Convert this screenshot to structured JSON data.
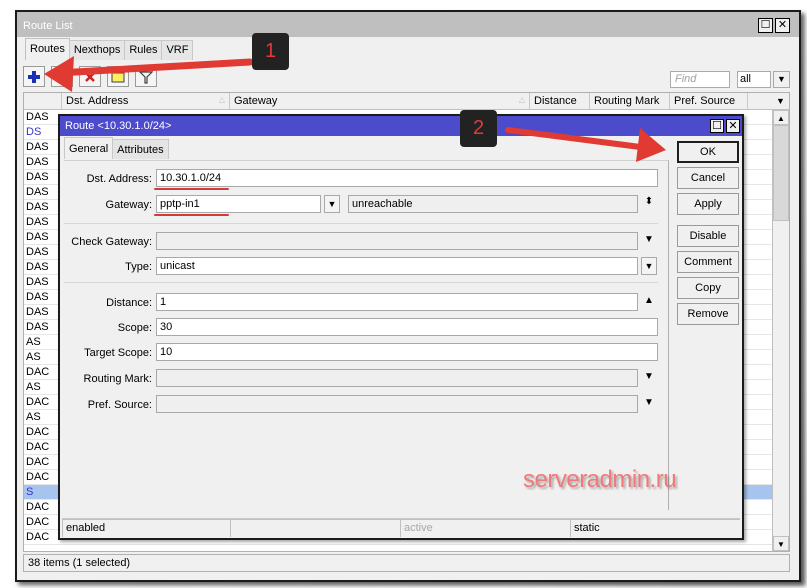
{
  "window": {
    "title": "Route List",
    "tabs": [
      "Routes",
      "Nexthops",
      "Rules",
      "VRF"
    ],
    "active_tab": "Routes",
    "maximize_icon": "maximize-icon",
    "close_icon": "close-icon"
  },
  "toolbar": {
    "buttons": [
      {
        "name": "add",
        "icon": "plus-icon"
      },
      {
        "name": "enable",
        "icon": "check-icon"
      },
      {
        "name": "disable",
        "icon": "x-icon"
      },
      {
        "name": "comment",
        "icon": "note-icon"
      },
      {
        "name": "filter",
        "icon": "filter-icon"
      }
    ],
    "find_placeholder": "Find",
    "filter_select": "all"
  },
  "table": {
    "columns": [
      "",
      "Dst. Address",
      "Gateway",
      "Distance",
      "Routing Mark",
      "Pref. Source"
    ],
    "rows": [
      {
        "flags": "DAS"
      },
      {
        "flags": "DS"
      },
      {
        "flags": "DAS"
      },
      {
        "flags": "DAS"
      },
      {
        "flags": "DAS"
      },
      {
        "flags": "DAS"
      },
      {
        "flags": "DAS"
      },
      {
        "flags": "DAS"
      },
      {
        "flags": "DAS"
      },
      {
        "flags": "DAS"
      },
      {
        "flags": "DAS"
      },
      {
        "flags": "DAS"
      },
      {
        "flags": "DAS"
      },
      {
        "flags": "DAS"
      },
      {
        "flags": "DAS"
      },
      {
        "flags": "AS"
      },
      {
        "flags": "AS"
      },
      {
        "flags": "DAC"
      },
      {
        "flags": "AS"
      },
      {
        "flags": "DAC"
      },
      {
        "flags": "AS"
      },
      {
        "flags": "DAC"
      },
      {
        "flags": "DAC"
      },
      {
        "flags": "DAC"
      },
      {
        "flags": "DAC"
      },
      {
        "flags": "S",
        "selected": true
      },
      {
        "flags": "DAC"
      },
      {
        "flags": "DAC"
      },
      {
        "flags": "DAC"
      }
    ]
  },
  "status": "38 items (1 selected)",
  "dialog": {
    "title": "Route <10.30.1.0/24>",
    "tabs": [
      "General",
      "Attributes"
    ],
    "active_tab": "General",
    "fields": {
      "dst_address": {
        "label": "Dst. Address:",
        "value": "10.30.1.0/24"
      },
      "gateway": {
        "label": "Gateway:",
        "value": "pptp-in1",
        "state": "unreachable"
      },
      "check_gateway": {
        "label": "Check Gateway:",
        "value": ""
      },
      "type": {
        "label": "Type:",
        "value": "unicast"
      },
      "distance": {
        "label": "Distance:",
        "value": "1"
      },
      "scope": {
        "label": "Scope:",
        "value": "30"
      },
      "target_scope": {
        "label": "Target Scope:",
        "value": "10"
      },
      "routing_mark": {
        "label": "Routing Mark:",
        "value": ""
      },
      "pref_source": {
        "label": "Pref. Source:",
        "value": ""
      }
    },
    "buttons": [
      "OK",
      "Cancel",
      "Apply",
      "Disable",
      "Comment",
      "Copy",
      "Remove"
    ],
    "status": [
      "enabled",
      "",
      "active",
      "static"
    ]
  },
  "annotations": {
    "badge1": "1",
    "badge2": "2",
    "watermark": "serveradmin.ru",
    "arrow_color": "#e03a32"
  }
}
